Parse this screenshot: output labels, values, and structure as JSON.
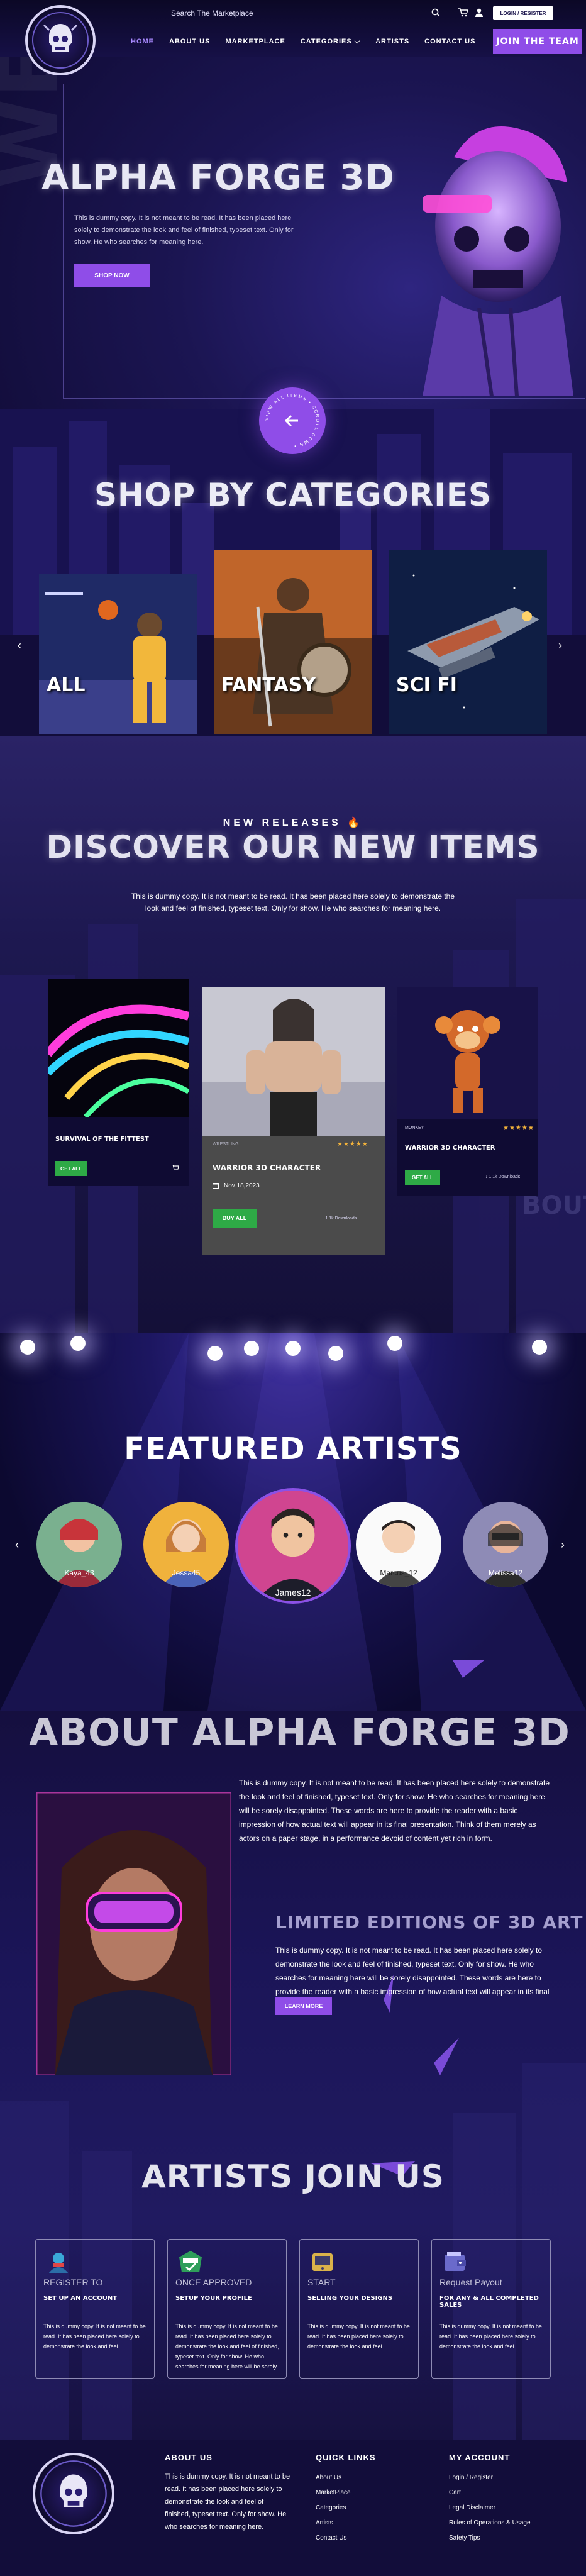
{
  "header": {
    "search_placeholder": "Search The Marketplace",
    "login_label": "LOGIN / REGISTER",
    "join_label": "JOIN THE TEAM",
    "nav": [
      "HOME",
      "ABOUT US",
      "MARKETPLACE",
      "CATEGORIES ⌵",
      "ARTISTS",
      "CONTACT US"
    ]
  },
  "hero": {
    "bg_word": "WELCOME",
    "title": "ALPHA FORGE 3D",
    "text": "This is dummy copy. It is not meant to be read. It has been placed here solely to demonstrate the look and feel of finished, typeset text. Only for show. He who searches for meaning here.",
    "cta": "SHOP NOW",
    "scroll_ring": "VIEW ALL ITEMS • SCROLL DOWN •"
  },
  "categories": {
    "title": "SHOP BY CATEGORIES",
    "items": [
      "ALL",
      "FANTASY",
      "SCI FI"
    ]
  },
  "new_releases": {
    "kicker": "NEW RELEASES 🔥",
    "title": "DISCOVER OUR NEW ITEMS",
    "text": "This is dummy copy. It is not meant to be read. It has been placed here solely to demonstrate the look and feel of finished, typeset text. Only for show. He who searches for meaning here.",
    "products": [
      {
        "name": "SURVIVAL OF THE FITTEST",
        "btn": "GET ALL"
      },
      {
        "category": "WRESTLING",
        "name": "WARRIOR 3D CHARACTER",
        "date": "Nov 18,2023",
        "btn": "BUY ALL",
        "downloads": "↓ 1.1k Downloads",
        "rating": "★★★★★"
      },
      {
        "category": "MONKEY",
        "name": "WARRIOR 3D CHARACTER",
        "btn": "GET ALL",
        "downloads": "↓ 1.1k Downloads",
        "rating": "★★★★★"
      }
    ]
  },
  "artists": {
    "title": "FEATURED ARTISTS",
    "items": [
      "Kaya_43",
      "Jessa45",
      "James12",
      "Marcus_12",
      "Melissa12"
    ]
  },
  "about": {
    "title": "ABOUT ALPHA FORGE 3D",
    "p1": "This is dummy copy. It is not meant to be read. It has been placed here solely to demonstrate the look and feel of finished, typeset text. Only for show. He who searches for meaning here will be sorely disappointed. These words are here to provide the reader with a basic impression of how actual text will appear in its final presentation. Think of them merely as actors on a paper stage, in a performance devoid of content yet rich in form.",
    "subtitle": "LIMITED EDITIONS OF 3D ART",
    "p2": "This is dummy copy. It is not meant to be read. It has been placed here solely to demonstrate the look and feel of finished, typeset text. Only for show. He who searches for meaning here will be sorely disappointed. These words are here to provide the reader with a basic impression of how actual text will appear in its final presentation.",
    "cta": "LEARN MORE"
  },
  "join": {
    "title": "ARTISTS JOIN US",
    "steps": [
      {
        "label": "REGISTER TO",
        "head": "SET UP AN ACCOUNT",
        "text": "This is dummy copy. It is not meant to be read. It has been placed here solely to demonstrate the look and feel."
      },
      {
        "label": "ONCE APPROVED",
        "head": "SETUP YOUR PROFILE",
        "text": "This is dummy copy. It is not meant to be read. It has been placed here solely to demonstrate the look and feel of finished, typeset text. Only for show. He who searches for meaning here will be sorely disappointed. These words are here to provide the reader with a basic impression of how actual text will appear in its final form."
      },
      {
        "label": "START",
        "head": "SELLING YOUR DESIGNS",
        "text": "This is dummy copy. It is not meant to be read. It has been placed here solely to demonstrate the look and feel."
      },
      {
        "label": "Request Payout",
        "head": "FOR ANY & ALL COMPLETED SALES",
        "text": "This is dummy copy. It is not meant to be read. It has been placed here solely to demonstrate the look and feel."
      }
    ]
  },
  "footer": {
    "about_head": "ABOUT US",
    "about_text": "This is dummy copy. It is not meant to be read. It has been placed here solely to demonstrate the look and feel of finished, typeset text. Only for show. He who searches for meaning here.",
    "quick_head": "QUICK LINKS",
    "quick_links": [
      "About Us",
      "MarketPlace",
      "Categories",
      "Artists",
      "Contact Us"
    ],
    "account_head": "MY ACCOUNT",
    "account_links": [
      "Login / Register",
      "Cart",
      "Legal Disclaimer",
      "Rules of Operations & Usage",
      "Safety Tips"
    ]
  },
  "colors": {
    "accent": "#8f4de8",
    "bg": "#120d3a",
    "green": "#2eaa46"
  }
}
